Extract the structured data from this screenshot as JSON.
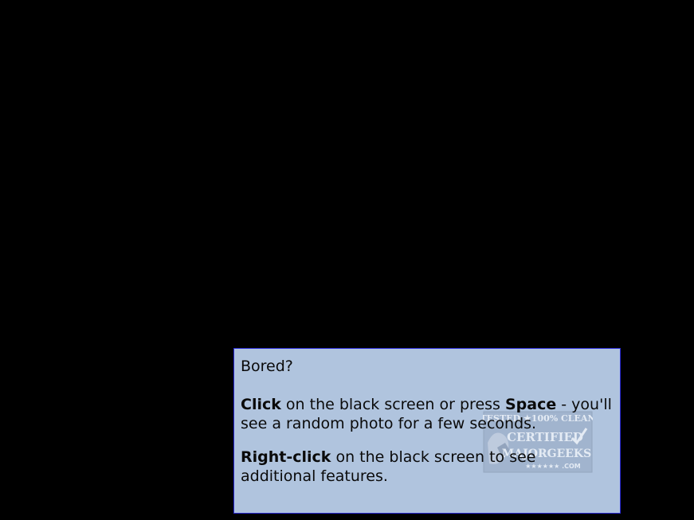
{
  "panel": {
    "title": "Bored?",
    "click_bold": "Click",
    "click_text_1": " on the black screen or press ",
    "space_bold": "Space",
    "click_text_2": " - you'll see a random photo for a few seconds.",
    "right_click_bold": "Right-click",
    "right_click_text": " on the black screen to see additional features."
  },
  "watermark": {
    "line1": "TESTED ★100% CLEAN",
    "line2": "CERTIFIED",
    "line3": "MAJORGEEKS",
    "line4": "★★★★★★ .COM"
  },
  "colors": {
    "screen_background": "#000000",
    "panel_background": "#b0c4de",
    "panel_border": "#2b2bd6",
    "text": "#0a0a0a"
  }
}
